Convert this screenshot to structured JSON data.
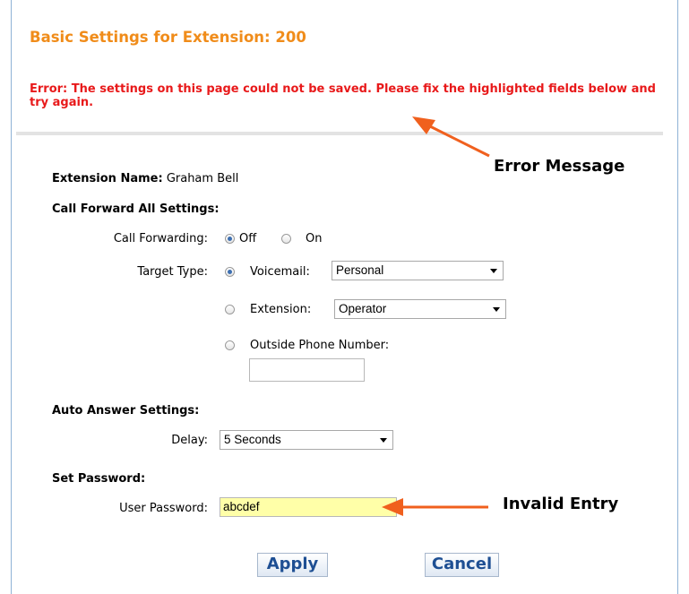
{
  "page": {
    "title": "Basic Settings for Extension: 200",
    "error_message": "Error: The settings on this page could not be saved. Please fix the highlighted fields below and try again."
  },
  "annotations": {
    "error_message_label": "Error Message",
    "invalid_entry_label": "Invalid Entry",
    "arrow_color": "#f0601e"
  },
  "extension": {
    "name_label": "Extension Name:",
    "name_value": "Graham Bell"
  },
  "call_forward": {
    "section_label": "Call Forward All Settings:",
    "forwarding_label": "Call Forwarding:",
    "forwarding_options": [
      "Off",
      "On"
    ],
    "forwarding_selected": "Off",
    "target_type_label": "Target Type:",
    "voicemail_label": "Voicemail:",
    "voicemail_value": "Personal",
    "extension_label": "Extension:",
    "extension_value": "Operator",
    "outside_label": "Outside Phone Number:",
    "outside_value": "",
    "target_selected": "Voicemail"
  },
  "auto_answer": {
    "section_label": "Auto Answer Settings:",
    "delay_label": "Delay:",
    "delay_value": "5 Seconds"
  },
  "password": {
    "section_label": "Set Password:",
    "user_password_label": "User Password:",
    "user_password_value": "abcdef",
    "invalid_highlight_color": "#ffffa8"
  },
  "buttons": {
    "apply": "Apply",
    "cancel": "Cancel"
  },
  "colors": {
    "title": "#f08c1a",
    "error": "#e8191a",
    "button_text": "#1e4f93"
  }
}
